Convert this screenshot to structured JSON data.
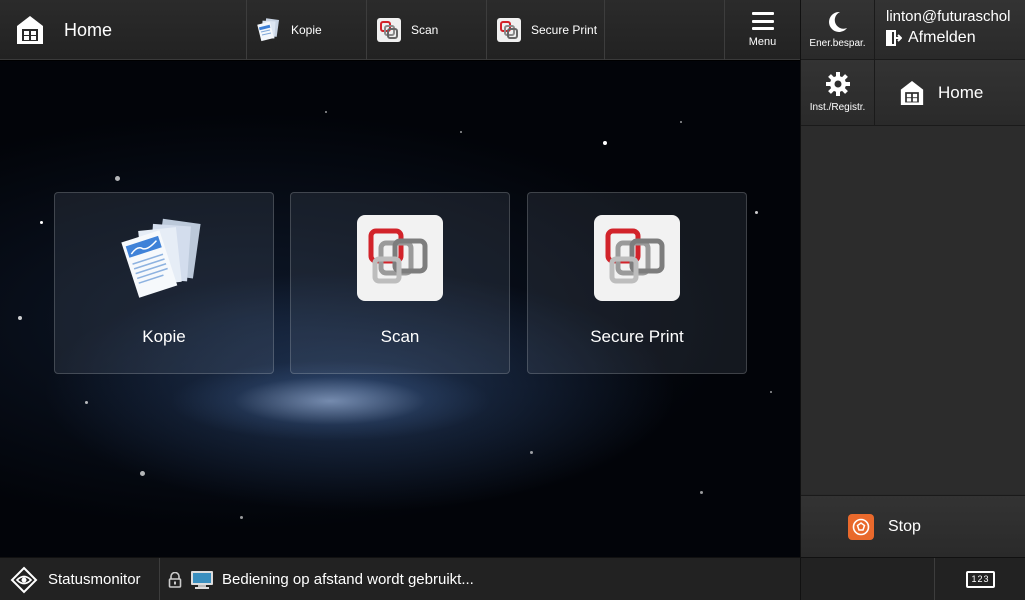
{
  "header": {
    "home_label": "Home",
    "quick_buttons": [
      {
        "label": "Kopie",
        "icon": "copy-icon"
      },
      {
        "label": "Scan",
        "icon": "scan-icon"
      },
      {
        "label": "Secure Print",
        "icon": "secure-print-icon"
      }
    ],
    "menu_label": "Menu"
  },
  "right_panel": {
    "energy_label": "Ener.bespar.",
    "user_name": "linton@futuraschol",
    "logout_label": "Afmelden",
    "settings_label": "Inst./Registr.",
    "home_label": "Home",
    "stop_label": "Stop",
    "keypad_label": "123"
  },
  "main": {
    "tiles": [
      {
        "label": "Kopie",
        "icon": "copy-icon"
      },
      {
        "label": "Scan",
        "icon": "scan-icon"
      },
      {
        "label": "Secure Print",
        "icon": "secure-print-icon"
      }
    ]
  },
  "status_bar": {
    "monitor_label": "Statusmonitor",
    "message": "Bediening op afstand wordt gebruikt..."
  },
  "colors": {
    "stop_accent": "#e9692c",
    "logo_red": "#d2232a",
    "logo_gray": "#7d7d7d"
  }
}
